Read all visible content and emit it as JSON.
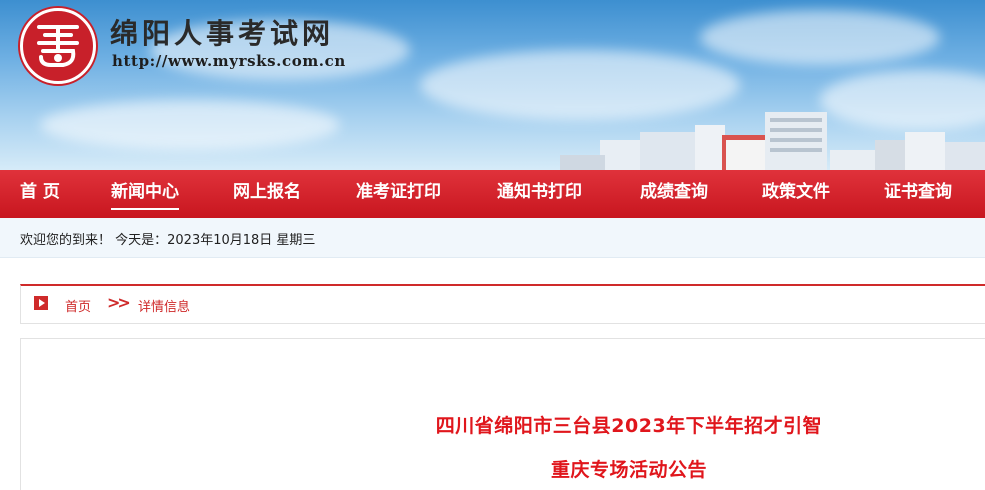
{
  "site": {
    "title": "绵阳人事考试网",
    "url": "http://www.myrsks.com.cn"
  },
  "nav": {
    "items": [
      {
        "label": "首 页",
        "active": false
      },
      {
        "label": "新闻中心",
        "active": true
      },
      {
        "label": "网上报名",
        "active": false
      },
      {
        "label": "准考证打印",
        "active": false
      },
      {
        "label": "通知书打印",
        "active": false
      },
      {
        "label": "成绩查询",
        "active": false
      },
      {
        "label": "政策文件",
        "active": false
      },
      {
        "label": "证书查询",
        "active": false
      }
    ]
  },
  "welcome": {
    "text": "欢迎您的到来！ 今天是：2023年10月18日 星期三"
  },
  "breadcrumb": {
    "home": "首页",
    "separator": ">>",
    "current": "详情信息"
  },
  "article": {
    "title_line1": "四川省绵阳市三台县2023年下半年招才引智",
    "title_line2": "重庆专场活动公告"
  },
  "colors": {
    "brand_red": "#c8161f",
    "title_red": "#e0161c",
    "sky_blue": "#6fb0e3"
  },
  "icons": {
    "logo": "seal-logo-icon",
    "breadcrumb": "play-square-icon"
  }
}
